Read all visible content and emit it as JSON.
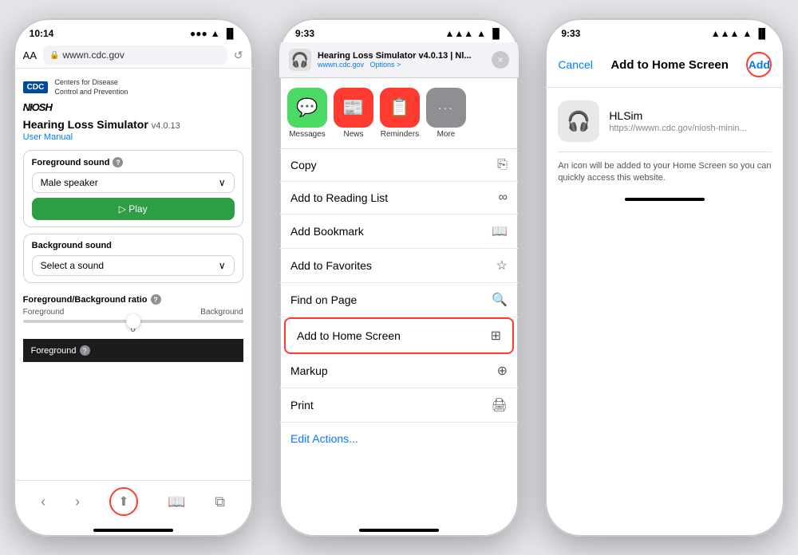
{
  "phone1": {
    "status_time": "10:14",
    "url": "wwwn.cdc.gov",
    "aa_label": "AA",
    "cdc_label": "CDC",
    "cdc_org": "Centers for Disease\nControl and Prevention",
    "niosh": "NIOSH",
    "page_title": "Hearing Loss Simulator",
    "version": "v4.0.13",
    "user_manual": "User Manual",
    "foreground_label": "Foreground sound",
    "foreground_value": "Male speaker",
    "play_label": "▷  Play",
    "background_label": "Background sound",
    "background_value": "Select a sound",
    "ratio_label": "Foreground/Background ratio",
    "ratio_left": "Foreground",
    "ratio_right": "Background",
    "ratio_value": "0",
    "foreground_bar_label": "Foreground"
  },
  "phone2": {
    "status_time": "9:33",
    "site_name": "Hearing Loss Simulator v4.0.13 | Nl...",
    "site_url": "wwwn.cdc.gov",
    "options_label": "Options >",
    "close_label": "×",
    "apps": [
      {
        "name": "Messages",
        "bg": "#4cd964",
        "icon": "💬"
      },
      {
        "name": "News",
        "bg": "#ff3b30",
        "icon": "📰"
      },
      {
        "name": "Reminders",
        "bg": "#ff3b30",
        "icon": "📋"
      },
      {
        "name": "More",
        "bg": "#8e8e93",
        "icon": "···"
      }
    ],
    "actions": [
      {
        "label": "Copy",
        "icon": "⎘",
        "highlighted": false
      },
      {
        "label": "Add to Reading List",
        "icon": "∞",
        "highlighted": false
      },
      {
        "label": "Add Bookmark",
        "icon": "📖",
        "highlighted": false
      },
      {
        "label": "Add to Favorites",
        "icon": "☆",
        "highlighted": false
      },
      {
        "label": "Find on Page",
        "icon": "🔍",
        "highlighted": false
      },
      {
        "label": "Add to Home Screen",
        "icon": "⊞",
        "highlighted": true
      },
      {
        "label": "Markup",
        "icon": "⊕",
        "highlighted": false
      },
      {
        "label": "Print",
        "icon": "🖨",
        "highlighted": false
      }
    ],
    "edit_actions": "Edit Actions..."
  },
  "phone3": {
    "status_time": "9:33",
    "cancel_label": "Cancel",
    "title": "Add to Home Screen",
    "add_label": "Add",
    "app_name": "HLSim",
    "app_url": "https://wwwn.cdc.gov/niosh-minin...",
    "description": "An icon will be added to your Home Screen so you can quickly access this website."
  }
}
